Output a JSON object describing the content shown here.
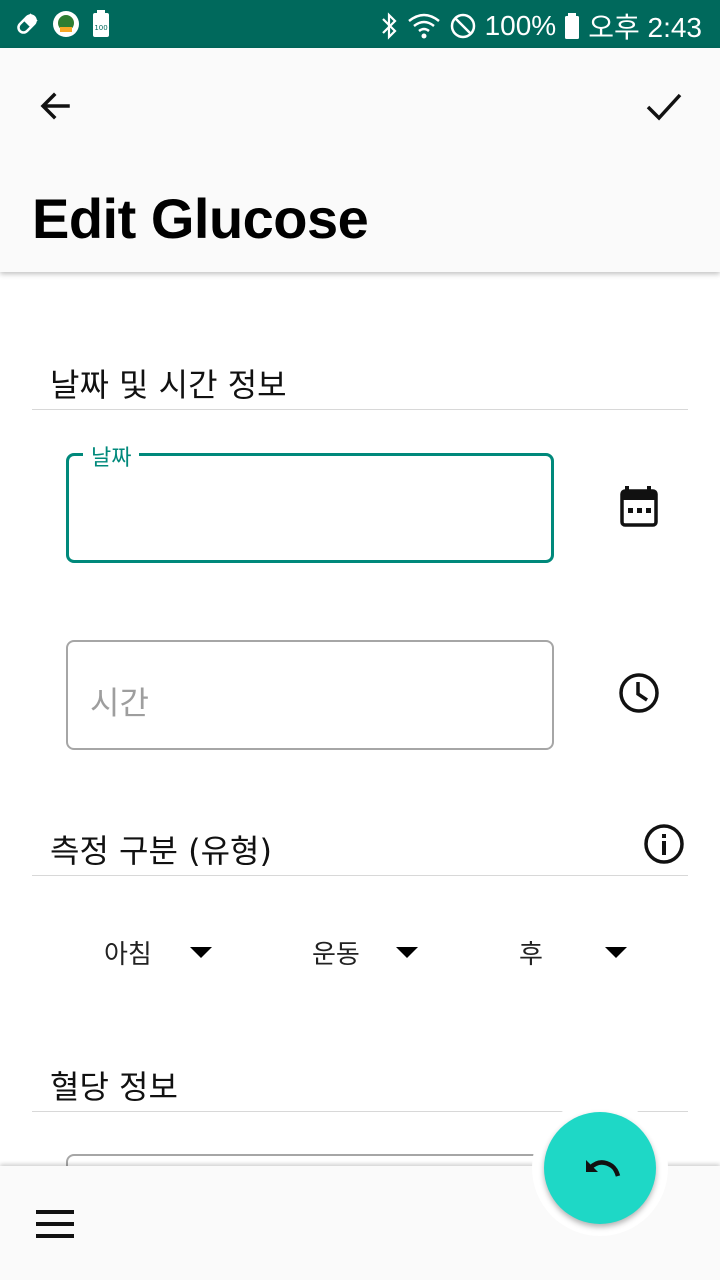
{
  "status_bar": {
    "battery_level": "100%",
    "time": "오후 2:43",
    "icons": [
      "pill-icon",
      "app-notification-icon",
      "battery-saver-icon",
      "bluetooth-icon",
      "wifi-icon",
      "do-not-disturb-icon",
      "battery-icon"
    ]
  },
  "app_bar": {
    "title": "Edit Glucose",
    "back_icon": "arrow-back-icon",
    "confirm_icon": "check-icon"
  },
  "sections": {
    "datetime_header": "날짜 및 시간 정보",
    "type_header": "측정 구분 (유형)",
    "glucose_header": "혈당 정보"
  },
  "fields": {
    "date": {
      "label": "날짜",
      "value": ""
    },
    "time": {
      "placeholder": "시간",
      "value": ""
    }
  },
  "dropdowns": {
    "meal_time": "아침",
    "activity": "운동",
    "timing": "후"
  },
  "colors": {
    "status_bar": "#00695c",
    "accent": "#00897b",
    "fab": "#1ed8c6"
  }
}
